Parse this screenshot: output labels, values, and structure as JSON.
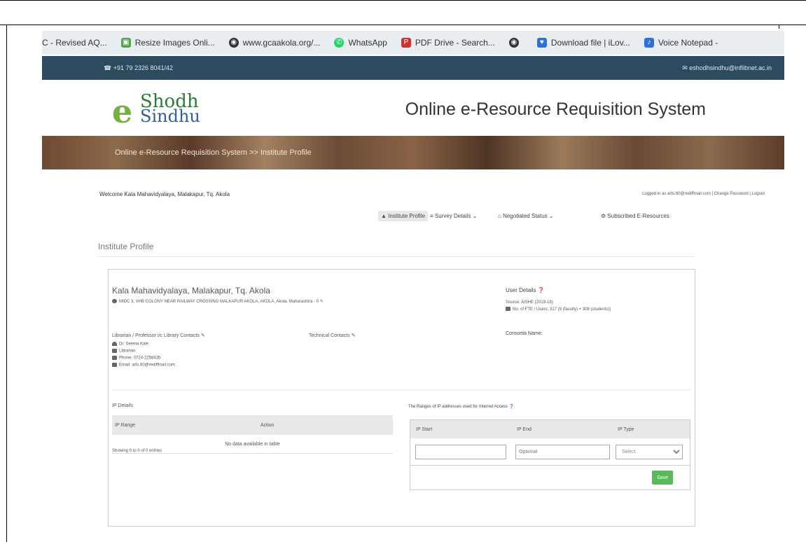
{
  "bookmarks": [
    {
      "label": "C - Revised AQ...",
      "icon": "doc-icon",
      "color": "#ffffff"
    },
    {
      "label": "Resize Images Onli...",
      "icon": "image-icon",
      "color": "#58a14e"
    },
    {
      "label": "www.gcaakola.org/...",
      "icon": "globe-icon",
      "color": "#333333"
    },
    {
      "label": "WhatsApp",
      "icon": "whatsapp-icon",
      "color": "#25d366"
    },
    {
      "label": "PDF Drive - Search...",
      "icon": "pdf-icon",
      "color": "#d2322d"
    },
    {
      "label": "",
      "icon": "globe-icon",
      "color": "#333333"
    },
    {
      "label": "Download file | iLov...",
      "icon": "ilovepdf-icon",
      "color": "#2f6fd6"
    },
    {
      "label": "Voice Notepad -",
      "icon": "mic-icon",
      "color": "#2f6fd6"
    }
  ],
  "topbar": {
    "phone": "+91 79 2326 8041/42",
    "email": "eshodhsindhu@inflibnet.ac.in"
  },
  "logo": {
    "e": "e",
    "line1": "Shodh",
    "line2": "Sindhu"
  },
  "site_title": "Online e-Resource Requisition System",
  "breadcrumb": "Online e-Resource Requisition System >> Institute Profile",
  "welcome": "Welcome Kala Mahavidyalaya, Malakapur, Tq. Akola",
  "account_links": "Logged in as arts.60@rediffmail.com | Change Password | Logout",
  "nav": {
    "institute_profile": "Institute Profile",
    "survey_details": "Survey Details",
    "negotiated_status": "Negotiated Status",
    "subscribed": "Subscribed E-Resources"
  },
  "section_title": "Institute Profile",
  "institute": {
    "name": "Kala Mahavidyalaya, Malakapur, Tq. Akola",
    "address": "MIDC 3, VHB COLONY NEAR RAILWAY CROSSING MALKAPUR AKOLA, AKOLA, Akola, Maharashtra - 0"
  },
  "user_details": {
    "heading": "User Details",
    "source": "Source: AISHE (2019-18)",
    "fte": "No. of FTE / Users: 317 (9 (faculty) + 308 (students))",
    "consortia": "Consortia Name:"
  },
  "librarian": {
    "heading": "Librarian / Professor i/c Library Contacts",
    "name": "Dr. Seema Kale",
    "designation": "Librarian",
    "phone": "Phone: 0724-2258435",
    "email": "Email: arts.60@rediffmail.com"
  },
  "technical": {
    "heading": "Technical Contacts"
  },
  "ip_details": {
    "heading": "IP Details",
    "col_range": "IP Range",
    "col_action": "Action",
    "empty": "No data available in table",
    "showing": "Showing 0 to 0 of 0 entries"
  },
  "ranges": {
    "heading": "The Ranges of IP addresses used for Internet Access",
    "col_start": "IP Start",
    "col_end": "IP End",
    "col_type": "IP Type",
    "end_placeholder": "Optional",
    "type_value": "Select",
    "save_label": "Save"
  }
}
